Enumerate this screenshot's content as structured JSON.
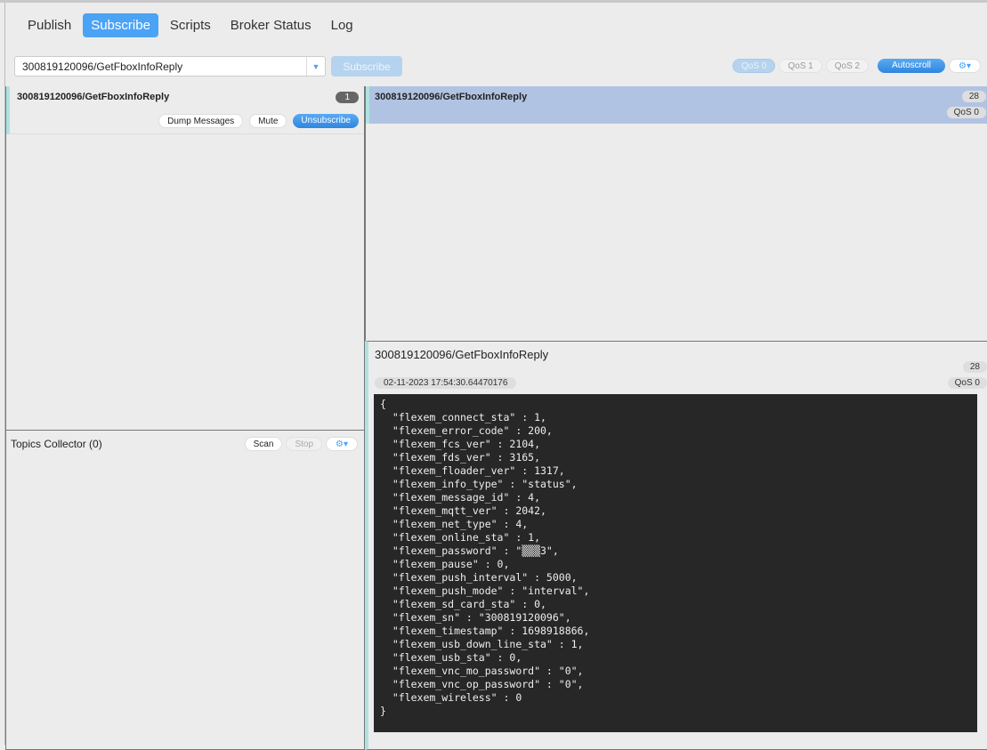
{
  "tabs": [
    {
      "label": "Publish"
    },
    {
      "label": "Subscribe",
      "active": true
    },
    {
      "label": "Scripts"
    },
    {
      "label": "Broker Status"
    },
    {
      "label": "Log"
    }
  ],
  "subscribe_bar": {
    "topic_value": "300819120096/GetFboxInfoReply",
    "subscribe_label": "Subscribe",
    "qos": [
      "QoS 0",
      "QoS 1",
      "QoS 2"
    ],
    "selected_qos": "QoS 0",
    "autoscroll_label": "Autoscroll",
    "settings_icon": "gear-dropdown-icon"
  },
  "subscriptions": [
    {
      "topic": "300819120096/GetFboxInfoReply",
      "count": "1",
      "dump_label": "Dump Messages",
      "mute_label": "Mute",
      "unsubscribe_label": "Unsubscribe"
    }
  ],
  "topics_collector": {
    "title": "Topics Collector (0)",
    "scan_label": "Scan",
    "stop_label": "Stop"
  },
  "messages": [
    {
      "topic": "300819120096/GetFboxInfoReply",
      "number": "28",
      "qos": "QoS 0"
    }
  ],
  "detail": {
    "topic": "300819120096/GetFboxInfoReply",
    "number": "28",
    "timestamp": "02-11-2023  17:54:30.64470176",
    "qos": "QoS 0",
    "payload": "{\n  \"flexem_connect_sta\" : 1,\n  \"flexem_error_code\" : 200,\n  \"flexem_fcs_ver\" : 2104,\n  \"flexem_fds_ver\" : 3165,\n  \"flexem_floader_ver\" : 1317,\n  \"flexem_info_type\" : \"status\",\n  \"flexem_message_id\" : 4,\n  \"flexem_mqtt_ver\" : 2042,\n  \"flexem_net_type\" : 4,\n  \"flexem_online_sta\" : 1,\n  \"flexem_password\" : \"▒▒▒3\",\n  \"flexem_pause\" : 0,\n  \"flexem_push_interval\" : 5000,\n  \"flexem_push_mode\" : \"interval\",\n  \"flexem_sd_card_sta\" : 0,\n  \"flexem_sn\" : \"300819120096\",\n  \"flexem_timestamp\" : 1698918866,\n  \"flexem_usb_down_line_sta\" : 1,\n  \"flexem_usb_sta\" : 0,\n  \"flexem_vnc_mo_password\" : \"0\",\n  \"flexem_vnc_op_password\" : \"0\",\n  \"flexem_wireless\" : 0\n}"
  }
}
